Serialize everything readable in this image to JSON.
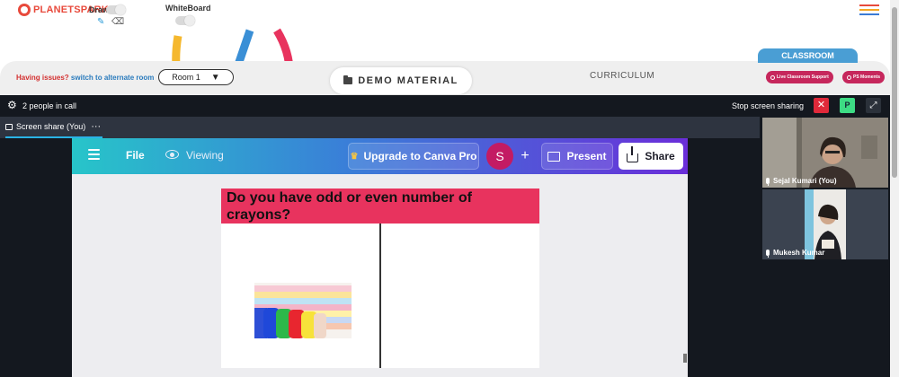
{
  "brand": {
    "logo_text": "PLANETSPARK",
    "logo_color": "#e84a3c"
  },
  "tools": {
    "draw_label": "Draw",
    "whiteboard_label": "WhiteBoard",
    "pencil_icon": "pencil-icon",
    "eraser_icon": "eraser-icon"
  },
  "room_bar": {
    "issue_prefix": "Having issues?",
    "issue_link": "switch to alternate room",
    "room_selected": "Room 1",
    "demo_material": "DEMO MATERIAL",
    "curriculum": "CURRICULUM",
    "classroom_tab": "CLASSROOM",
    "live_support": "Live Classroom Support",
    "ps_moments": "PS Moments"
  },
  "call": {
    "people_count": "2 people in call",
    "stop_sharing": "Stop screen sharing",
    "p_badge": "P",
    "share_tab": "Screen share (You)",
    "more": "···"
  },
  "canva": {
    "file": "File",
    "viewing": "Viewing",
    "upgrade": "Upgrade to Canva Pro",
    "avatar_letter": "S",
    "present": "Present",
    "share": "Share"
  },
  "slide": {
    "title": "Do you have odd or even number of crayons?"
  },
  "participants": [
    {
      "name": "Sejal Kumari (You)"
    },
    {
      "name": "Mukesh Kumar"
    }
  ],
  "colors": {
    "accent_red": "#d32f2f",
    "accent_blue": "#2a7bbd",
    "pink_button": "#c6275c",
    "canva_gradient_start": "#27c5c9",
    "canva_gradient_end": "#6a2ed9"
  }
}
